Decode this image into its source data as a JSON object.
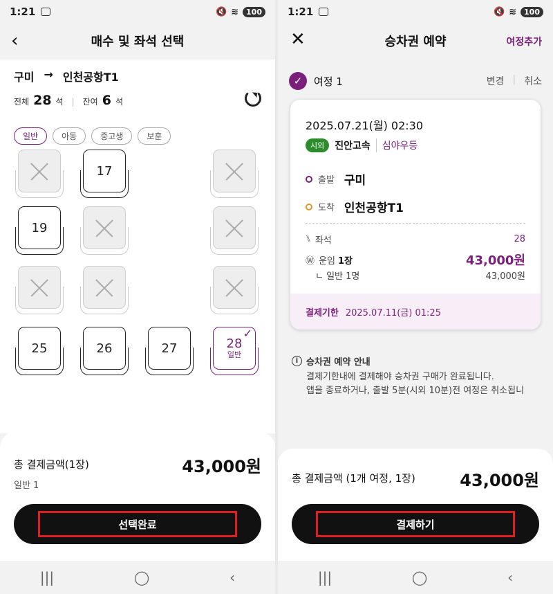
{
  "status": {
    "time": "1:21",
    "battery": "100"
  },
  "left": {
    "title": "매수 및 좌석 선택",
    "route": {
      "from": "구미",
      "arrow": "→",
      "to": "인천공항T1"
    },
    "seats_summary": {
      "total_label": "전체",
      "total": "28",
      "unit": "석",
      "remain_label": "잔여",
      "remain": "6"
    },
    "chips": [
      "일반",
      "아동",
      "중고생",
      "보훈"
    ],
    "seats": [
      {
        "num": "",
        "available": false
      },
      {
        "num": "17",
        "available": true
      },
      {
        "num": "",
        "available": false
      },
      {
        "num": "19",
        "available": true
      },
      {
        "num": "",
        "available": false
      },
      {
        "num": "",
        "available": false
      },
      {
        "num": "",
        "available": false
      },
      {
        "num": "",
        "available": false
      },
      {
        "num": "",
        "available": false
      },
      {
        "num": "25",
        "available": true
      },
      {
        "num": "26",
        "available": true
      },
      {
        "num": "27",
        "available": true
      },
      {
        "num": "28",
        "available": true,
        "selected": true,
        "type": "일반"
      }
    ],
    "total_label": "총 결제금액(1장)",
    "total_amount": "43,000원",
    "total_sub": "일반 1",
    "cta": "선택완료"
  },
  "right": {
    "title": "승차권 예약",
    "add_trip": "여정추가",
    "trip_label": "여정 1",
    "change": "변경",
    "cancel": "취소",
    "date": "2025.07.21(월) 02:30",
    "tag": "시외",
    "company": "진안고속",
    "grade": "심야우등",
    "depart_label": "출발",
    "depart": "구미",
    "arrive_label": "도착",
    "arrive": "인천공항T1",
    "seat_label": "좌석",
    "seat_value": "28",
    "fare_label": "운임",
    "fare_count": "1장",
    "fare_value": "43,000원",
    "fare_sub_label": "ㄴ 일반 1명",
    "fare_sub_value": "43,000원",
    "deadline_label": "결제기한",
    "deadline_value": "2025.07.11(금) 01:25",
    "notice_title": "승차권 예약 안내",
    "notice_line1": "결제기한내에 결제해야 승차권 구매가 완료됩니다.",
    "notice_line2": "앱을 종료하거나, 출발 5분(시외 10분)전 여정은 취소됩니",
    "total_label": "총 결제금액 (1개 여정, 1장)",
    "total_amount": "43,000원",
    "cta": "결제하기"
  }
}
